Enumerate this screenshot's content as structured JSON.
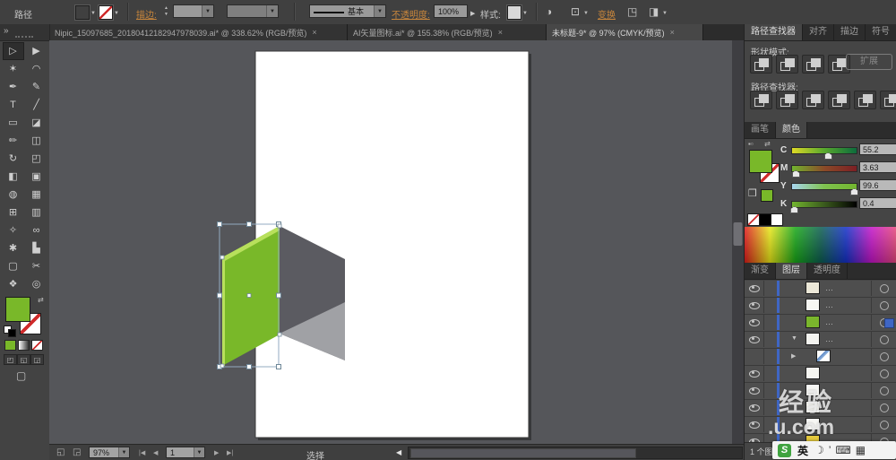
{
  "top_bar": {
    "selection_type": "路径",
    "stroke_label": "描边:",
    "stroke_style_label": "基本",
    "opacity_label": "不透明度:",
    "opacity_value": "100%",
    "style_label": "样式:",
    "transform_label": "变换",
    "fill_color": "#79b829"
  },
  "document_tabs": [
    {
      "title": "Nipic_15097685_20180412182947978039.ai* @ 338.62% (RGB/预览)",
      "close": "×"
    },
    {
      "title": "AI矢量图标.ai* @ 155.38% (RGB/预览)",
      "close": "×"
    },
    {
      "title": "未标题-9* @ 97% (CMYK/预览)",
      "close": "×"
    }
  ],
  "tool_panel": {
    "collapse_icon": "»",
    "tools": [
      {
        "name": "direct-selection-tool",
        "glyph": "▷",
        "selected": true
      },
      {
        "name": "selection-tool",
        "glyph": "▶"
      },
      {
        "name": "magic-wand-tool",
        "glyph": "✶"
      },
      {
        "name": "lasso-tool",
        "glyph": "◠"
      },
      {
        "name": "pen-tool",
        "glyph": "✒"
      },
      {
        "name": "width-tool",
        "glyph": "✎"
      },
      {
        "name": "type-tool",
        "glyph": "T"
      },
      {
        "name": "line-segment-tool",
        "glyph": "╱"
      },
      {
        "name": "rectangle-tool",
        "glyph": "▭"
      },
      {
        "name": "paintbrush-tool",
        "glyph": "◪"
      },
      {
        "name": "pencil-tool",
        "glyph": "✏"
      },
      {
        "name": "eraser-tool",
        "glyph": "◫"
      },
      {
        "name": "rotate-tool",
        "glyph": "↻"
      },
      {
        "name": "scale-tool",
        "glyph": "◰"
      },
      {
        "name": "width-profile-tool",
        "glyph": "◧"
      },
      {
        "name": "free-transform-tool",
        "glyph": "▣"
      },
      {
        "name": "shape-builder-tool",
        "glyph": "◍"
      },
      {
        "name": "perspective-grid-tool",
        "glyph": "▦"
      },
      {
        "name": "mesh-tool",
        "glyph": "⊞"
      },
      {
        "name": "gradient-tool",
        "glyph": "▥"
      },
      {
        "name": "eyedropper-tool",
        "glyph": "✧"
      },
      {
        "name": "blend-tool",
        "glyph": "∞"
      },
      {
        "name": "symbol-sprayer-tool",
        "glyph": "✱"
      },
      {
        "name": "column-graph-tool",
        "glyph": "▙"
      },
      {
        "name": "artboard-tool",
        "glyph": "▢"
      },
      {
        "name": "slice-tool",
        "glyph": "✂"
      },
      {
        "name": "hand-tool",
        "glyph": "❖"
      },
      {
        "name": "zoom-tool",
        "glyph": "◎"
      }
    ]
  },
  "pathfinder_panel": {
    "tabs": [
      "路径查找器",
      "对齐",
      "描边",
      "符号"
    ],
    "shape_modes_label": "形状模式:",
    "expand_button": "扩展",
    "pathfinders_label": "路径查找器:",
    "shape_mode_icons": [
      "unite-icon",
      "minus-front-icon",
      "intersect-icon",
      "exclude-icon"
    ],
    "pathfinder_icons": [
      "divide-icon",
      "trim-icon",
      "merge-icon",
      "crop-icon",
      "outline-icon",
      "minus-back-icon"
    ]
  },
  "color_panel": {
    "tabs": [
      "画笔",
      "颜色"
    ],
    "channels": [
      {
        "label": "C",
        "value": "55.2",
        "pos": 55,
        "gradient": "linear-gradient(90deg,#ded926,#58a82e,#0c6b3c)"
      },
      {
        "label": "M",
        "value": "3.63",
        "pos": 5,
        "gradient": "linear-gradient(90deg,#72b32e,#8a4a28,#7c1f24)"
      },
      {
        "label": "Y",
        "value": "99.6",
        "pos": 96,
        "gradient": "linear-gradient(90deg,#a7d5ee,#7fc24f,#72b52e)"
      },
      {
        "label": "K",
        "value": "0.4",
        "pos": 3,
        "gradient": "linear-gradient(90deg,#72b52e,#3a5a1d,#000000)"
      }
    ],
    "fill_color": "#79b829"
  },
  "lower_tabs": [
    "渐变",
    "图层",
    "透明度"
  ],
  "layers_panel": {
    "rows": [
      {
        "thumb": "#ece8d8",
        "eye": true,
        "bar": true,
        "dots": "…"
      },
      {
        "thumb": "#f7f7f3",
        "eye": true,
        "bar": true,
        "dots": "…"
      },
      {
        "thumb": "#7ab62c",
        "eye": true,
        "bar": true,
        "dots": "…",
        "selected": true
      },
      {
        "thumb": "#f4f4f0",
        "eye": true,
        "bar": true,
        "dots": "…",
        "expander": "▼"
      },
      {
        "thumb": "linear-gradient(135deg,#ffffff 35%,#5b86c5 35%,#8fb3dd 55%,#ffffff 55%)",
        "eye": false,
        "bar": true,
        "expander": "▶",
        "indent": true
      },
      {
        "thumb": "#f5f5f1",
        "eye": true,
        "bar": true
      },
      {
        "thumb": "#f7f7f4",
        "eye": true,
        "bar": true
      },
      {
        "thumb": "#f5f5f1",
        "eye": true,
        "bar": true
      },
      {
        "thumb": "#f7f7f4",
        "eye": true,
        "bar": true
      },
      {
        "thumb": "#e3c83d",
        "eye": true,
        "bar": true
      }
    ],
    "footer": "1 个图层"
  },
  "status_bar": {
    "zoom": "97%",
    "artboard_number": "1",
    "status_text": "选择"
  },
  "canvas": {
    "colors": {
      "green": "#79b829",
      "green_highlight": "#b8e05c",
      "dark_side": "#5b5b61",
      "light_shadow": "#a0a1a5",
      "artboard": "#ffffff"
    }
  },
  "watermark": {
    "line1": "经验",
    "line2": ".u.com"
  },
  "ime_bar": {
    "logo": "S",
    "lang": "英",
    "icons": [
      {
        "name": "moon-icon",
        "glyph": "☽"
      },
      {
        "name": "comma-icon",
        "glyph": "’"
      },
      {
        "name": "keyboard-icon",
        "glyph": "⌨"
      },
      {
        "name": "toolbox-icon",
        "glyph": "▦"
      }
    ]
  }
}
